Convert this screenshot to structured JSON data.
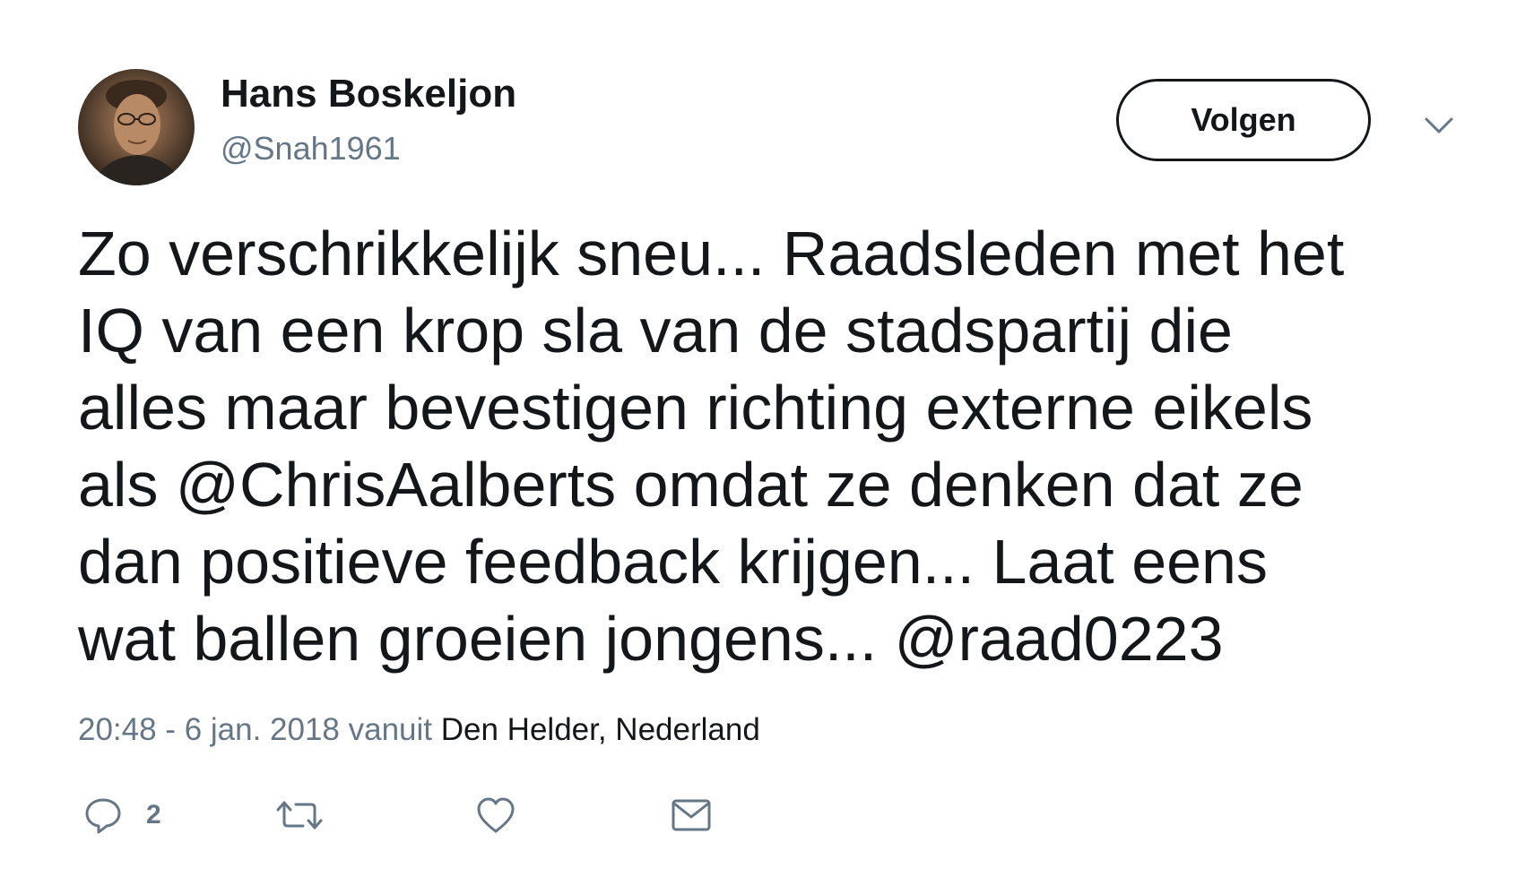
{
  "user": {
    "name": "Hans Boskeljon",
    "handle": "@Snah1961"
  },
  "follow_label": "Volgen",
  "tweet": {
    "lines": [
      "Zo verschrikkelijk sneu... Raadsleden met het",
      "IQ van een krop sla van de stadspartij die",
      "alles maar bevestigen richting externe eikels",
      "als @ChrisAalberts omdat ze denken dat ze",
      "dan positieve feedback krijgen... Laat eens",
      "wat ballen groeien jongens... @raad0223"
    ]
  },
  "meta": {
    "time_date": "20:48 - 6 jan. 2018 vanuit ",
    "location": "Den Helder, Nederland"
  },
  "actions": {
    "reply_count": "2"
  },
  "icons": {
    "menu": "chevron-down-icon",
    "reply": "speech-bubble-icon",
    "retweet": "retweet-icon",
    "like": "heart-icon",
    "dm": "envelope-icon"
  },
  "colors": {
    "text": "#14171a",
    "secondary": "#657786"
  }
}
